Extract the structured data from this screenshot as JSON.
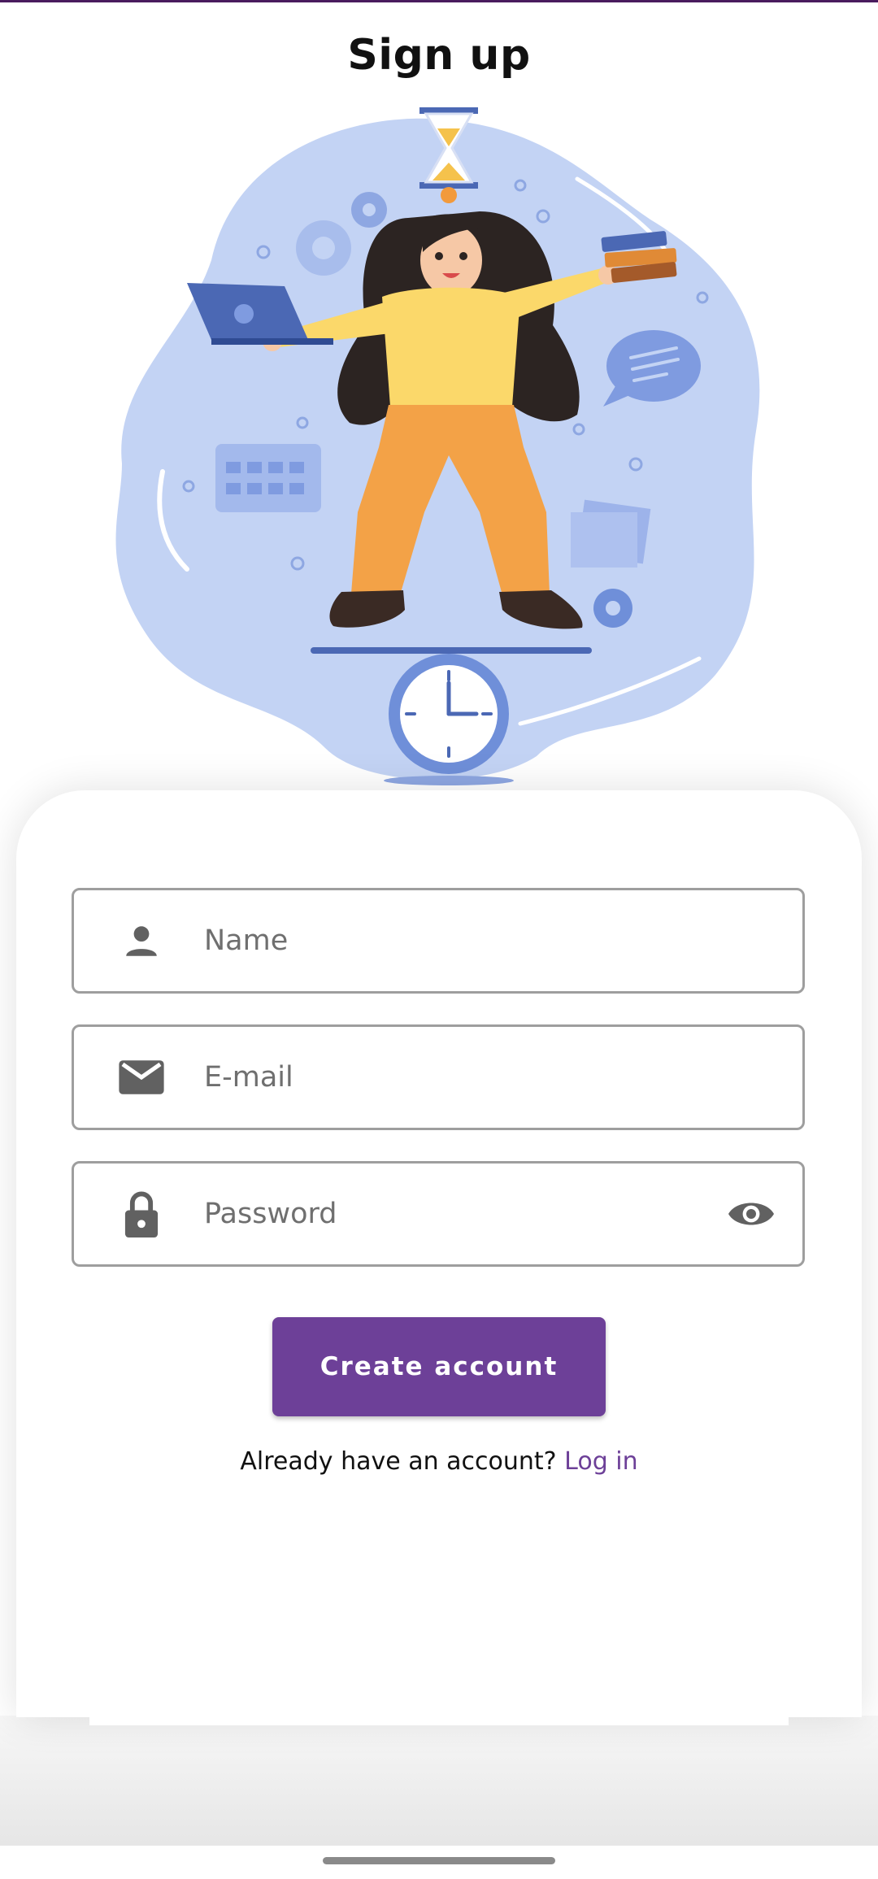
{
  "header": {
    "title": "Sign up"
  },
  "form": {
    "name_placeholder": "Name",
    "email_placeholder": "E-mail",
    "password_placeholder": "Password",
    "submit_label": "Create account"
  },
  "footer": {
    "prompt": "Already have an account?",
    "login_link": "Log in"
  },
  "colors": {
    "accent": "#6d4098",
    "illustration_blob": "#c3d3f4",
    "field_border": "#9e9e9e"
  },
  "icons": [
    "person-icon",
    "mail-icon",
    "lock-icon",
    "eye-icon"
  ]
}
